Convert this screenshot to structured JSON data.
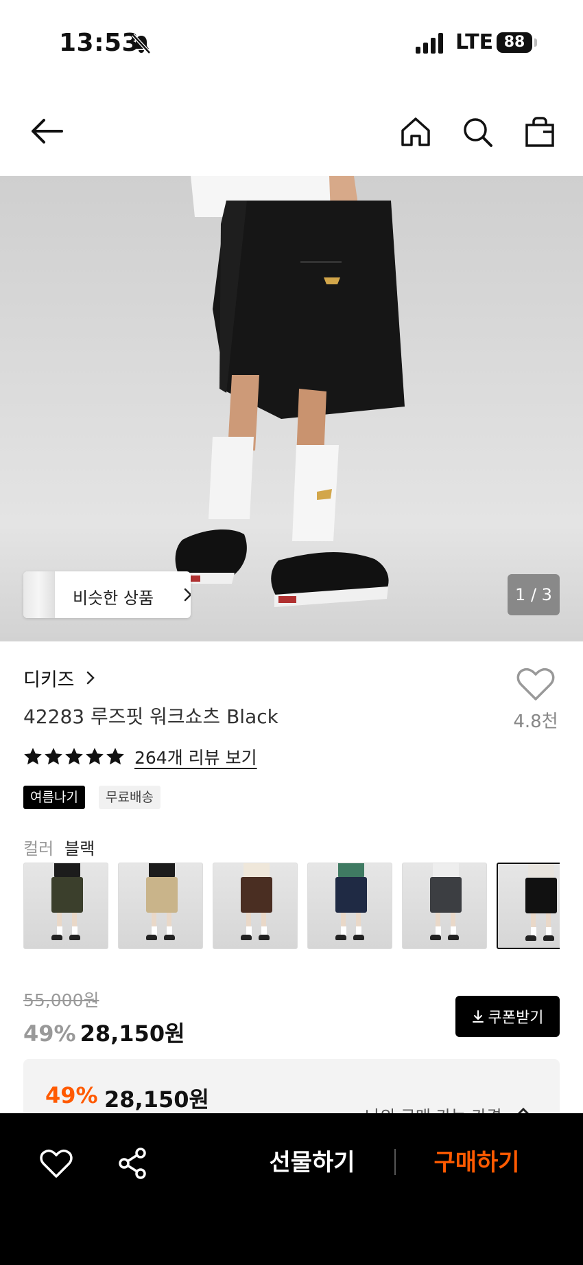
{
  "status_bar": {
    "time": "13:53",
    "network": "LTE",
    "battery": "88"
  },
  "nav": {
    "icons": [
      "arrow-left-icon",
      "home-icon",
      "search-icon",
      "shopping-bag-icon"
    ]
  },
  "hero": {
    "similar_label": "비슷한 상품",
    "counter": "1 / 3"
  },
  "product": {
    "brand": "디키즈",
    "title": "42283 루즈핏 워크쇼츠 Black",
    "like_count": "4.8천",
    "rating_stars": 5,
    "review_link": "264개 리뷰 보기",
    "badges": [
      "여름나기",
      "무료배송"
    ],
    "color_label": "컬러",
    "color_value": "블랙",
    "swatches": [
      {
        "top": "#1c1c1c",
        "shorts": "#3b3f2c"
      },
      {
        "top": "#1c1c1c",
        "shorts": "#c9b48a"
      },
      {
        "top": "#efe7da",
        "shorts": "#4a2e22"
      },
      {
        "top": "#3f7a62",
        "shorts": "#1f2a44"
      },
      {
        "top": "#eeeeee",
        "shorts": "#3c3e42"
      },
      {
        "top": "#e8e4de",
        "shorts": "#111111"
      }
    ]
  },
  "price": {
    "original": "55,000원",
    "discount_pct": "49%",
    "sale_price": "28,150원",
    "coupon_label": "쿠폰받기",
    "my_price_pct": "49%",
    "my_price_value": "28,150원",
    "my_price_label": "나의 구매 가능 가격"
  },
  "bottom_bar": {
    "gift_label": "선물하기",
    "buy_label": "구매하기"
  },
  "colors": {
    "accent": "#ff5a00",
    "black": "#000000"
  }
}
